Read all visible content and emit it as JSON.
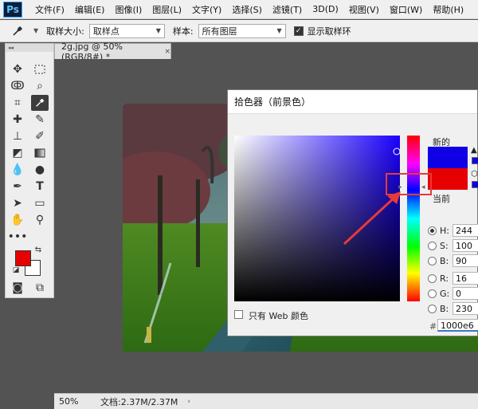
{
  "app": {
    "logo": "Ps"
  },
  "menu": [
    "文件(F)",
    "编辑(E)",
    "图像(I)",
    "图层(L)",
    "文字(Y)",
    "选择(S)",
    "滤镜(T)",
    "3D(D)",
    "视图(V)",
    "窗口(W)",
    "帮助(H)"
  ],
  "options": {
    "sample_size_label": "取样大小:",
    "sample_size_value": "取样点",
    "sample_label": "样本:",
    "sample_value": "所有图层",
    "show_ring_label": "显示取样环",
    "show_ring_checked": true
  },
  "document": {
    "tab_label": "2g.jpg @ 50%(RGB/8#) *",
    "close_glyph": "×"
  },
  "status": {
    "zoom": "50%",
    "doc_info": "文档:2.37M/2.37M",
    "arrow": "›"
  },
  "picker": {
    "title": "拾色器（前景色）",
    "new_label": "新的",
    "current_label": "当前",
    "web_only_label": "只有 Web 颜色",
    "new_color": "#1000e6",
    "current_color": "#e60000",
    "fields": [
      {
        "key": "H",
        "value": "244",
        "selected": true
      },
      {
        "key": "S",
        "value": "100",
        "selected": false
      },
      {
        "key": "B",
        "value": "90",
        "selected": false
      },
      {
        "key": "R",
        "value": "16",
        "selected": false
      },
      {
        "key": "G",
        "value": "0",
        "selected": false
      },
      {
        "key": "B",
        "value": "230",
        "selected": false
      }
    ],
    "hex_label": "#",
    "hex_value": "1000e6"
  },
  "toolbar_colors": {
    "foreground": "#e60000",
    "background": "#ffffff"
  },
  "icons": [
    "move-icon",
    "marquee-icon",
    "lasso-icon",
    "quick-select-icon",
    "crop-icon",
    "eyedropper-icon",
    "healing-brush-icon",
    "brush-icon",
    "stamp-icon",
    "history-brush-icon",
    "eraser-icon",
    "gradient-icon",
    "blur-icon",
    "dodge-icon",
    "pen-icon",
    "type-icon",
    "path-select-icon",
    "rectangle-icon",
    "hand-icon",
    "zoom-icon",
    "more-tools-icon"
  ],
  "accent": {
    "annotation_red": "#e8393a"
  }
}
